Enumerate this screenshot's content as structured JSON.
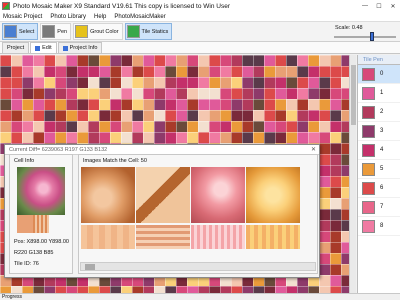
{
  "window": {
    "title": "Photo Mosaic Maker X9 Standard V19.61   This copy is licensed to Win User"
  },
  "menu": [
    "Mosaic Project",
    "Photo Library",
    "Help",
    "PhotoMosaicMaker"
  ],
  "toolbar": {
    "buttons": [
      {
        "label": "Select",
        "active": true,
        "color": "#4a7fd1"
      },
      {
        "label": "Pen",
        "active": false,
        "color": "#7a7a7a"
      },
      {
        "label": "Grout Color",
        "active": false,
        "color": "#e6c21b"
      },
      {
        "label": "Tile Statics",
        "active": true,
        "color": "#3aa84a"
      }
    ],
    "scale_label": "Scale: 0.48"
  },
  "tabs": [
    "Project",
    "Edit",
    "Project Info"
  ],
  "tile_pen": {
    "header": "Tile Pen",
    "items": [
      {
        "label": "0",
        "color": "#d7487a"
      },
      {
        "label": "1",
        "color": "#e05a9a"
      },
      {
        "label": "2",
        "color": "#b23a5c"
      },
      {
        "label": "3",
        "color": "#8e3a6a"
      },
      {
        "label": "4",
        "color": "#c4306a"
      },
      {
        "label": "5",
        "color": "#ea9a3a"
      },
      {
        "label": "6",
        "color": "#dc4a4a"
      },
      {
        "label": "7",
        "color": "#e8668a"
      },
      {
        "label": "8",
        "color": "#f07aa2"
      }
    ]
  },
  "dialog": {
    "title": "Current Diff= 6239063 R197 G133 B132",
    "cell_info": {
      "title": "Cell Info",
      "pos": "Pos: X898.00 Y898.00",
      "rgb": "R220 G138 B85",
      "tile_id": "Tile ID: 76",
      "swatch_colors": [
        "#e8a074",
        "#dd8a55"
      ]
    },
    "matches": {
      "title": "Images Match the Cell: 50",
      "images": [
        {
          "color_a": "#f3c7a0",
          "color_b": "#d4804a"
        },
        {
          "color_a": "#f1c69a",
          "color_b": "#b5652e"
        },
        {
          "color_a": "#f7aab0",
          "color_b": "#d86a74"
        },
        {
          "color_a": "#fbd07a",
          "color_b": "#e59a3a"
        }
      ]
    }
  },
  "status": "Progress"
}
